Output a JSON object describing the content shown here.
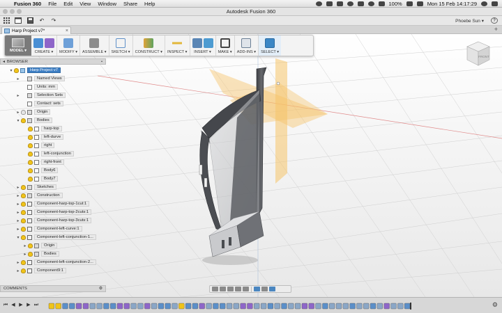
{
  "menubar": {
    "app_name": "Fusion 360",
    "items": [
      "File",
      "Edit",
      "View",
      "Window",
      "Share",
      "Help"
    ],
    "battery": "100%",
    "clock": "Mon 15 Feb  14:17:29"
  },
  "window": {
    "title": "Autodesk Fusion 360"
  },
  "quickbar": {
    "user": "Phoebe Sun ▾",
    "help": "?"
  },
  "document_tab": {
    "label": "Harp Project v7*",
    "close": "×"
  },
  "toolbar": {
    "workspace": "MODEL ▾",
    "groups": [
      {
        "label": "CREATE ▾",
        "colors": [
          "#4a8fd4",
          "#8e66c9"
        ]
      },
      {
        "label": "MODIFY ▾",
        "colors": [
          "#6ea0d8"
        ]
      },
      {
        "label": "ASSEMBLE ▾",
        "colors": [
          "#8d8d8d"
        ]
      },
      {
        "label": "SKETCH ▾",
        "colors": [
          "#5f90c8"
        ]
      },
      {
        "label": "CONSTRUCT ▾",
        "colors": [
          "#e0a33a"
        ]
      },
      {
        "label": "INSPECT ▾",
        "colors": [
          "#e2b73a"
        ]
      },
      {
        "label": "INSERT ▾",
        "colors": [
          "#5a86b5",
          "#4d9bd1"
        ]
      },
      {
        "label": "MAKE ▾",
        "colors": [
          "#444444"
        ]
      },
      {
        "label": "ADD-INS ▾",
        "colors": [
          "#6b7f95"
        ]
      },
      {
        "label": "SELECT ▾",
        "colors": [
          "#3b87c6"
        ]
      }
    ]
  },
  "viewcube": {
    "face": "FRONT"
  },
  "browser": {
    "header": "BROWSER",
    "nodes": [
      {
        "label": "Harp Project v7",
        "depth": 0,
        "expanded": true,
        "icon": "root",
        "bulb": "on",
        "selected": true
      },
      {
        "label": "Named Views",
        "depth": 1,
        "expanded": false,
        "icon": "folder",
        "bulb": "none"
      },
      {
        "label": "Units: mm",
        "depth": 1,
        "expanded": null,
        "icon": "box",
        "bulb": "none"
      },
      {
        "label": "Selection Sets",
        "depth": 1,
        "expanded": false,
        "icon": "folder",
        "bulb": "none"
      },
      {
        "label": "Contact: sets",
        "depth": 1,
        "expanded": null,
        "icon": "box",
        "bulb": "none"
      },
      {
        "label": "Origin",
        "depth": 1,
        "expanded": false,
        "icon": "folder",
        "bulb": "off"
      },
      {
        "label": "Bodies",
        "depth": 1,
        "expanded": true,
        "icon": "folder",
        "bulb": "on"
      },
      {
        "label": "harp-top",
        "depth": 2,
        "expanded": null,
        "icon": "box",
        "bulb": "on"
      },
      {
        "label": "left-durve",
        "depth": 2,
        "expanded": null,
        "icon": "box",
        "bulb": "on"
      },
      {
        "label": "right",
        "depth": 2,
        "expanded": null,
        "icon": "box",
        "bulb": "on"
      },
      {
        "label": "left-conjunction",
        "depth": 2,
        "expanded": null,
        "icon": "box",
        "bulb": "on"
      },
      {
        "label": "right-front",
        "depth": 2,
        "expanded": null,
        "icon": "box",
        "bulb": "on"
      },
      {
        "label": "Body6",
        "depth": 2,
        "expanded": null,
        "icon": "box",
        "bulb": "on"
      },
      {
        "label": "Body7",
        "depth": 2,
        "expanded": null,
        "icon": "box",
        "bulb": "on"
      },
      {
        "label": "Sketches",
        "depth": 1,
        "expanded": false,
        "icon": "folder",
        "bulb": "on"
      },
      {
        "label": "Construction",
        "depth": 1,
        "expanded": false,
        "icon": "folder",
        "bulb": "on"
      },
      {
        "label": "Component-harp-top-1cut:1",
        "depth": 1,
        "expanded": false,
        "icon": "comp",
        "bulb": "on"
      },
      {
        "label": "Component-harp-top-2cuts:1",
        "depth": 1,
        "expanded": false,
        "icon": "comp",
        "bulb": "on"
      },
      {
        "label": "Component-harp-top-3cuts:1",
        "depth": 1,
        "expanded": false,
        "icon": "comp",
        "bulb": "on"
      },
      {
        "label": "Component-left-curve:1",
        "depth": 1,
        "expanded": false,
        "icon": "comp",
        "bulb": "on"
      },
      {
        "label": "Component-left-conjunction-1...",
        "depth": 1,
        "expanded": true,
        "icon": "comp",
        "bulb": "on"
      },
      {
        "label": "Origin",
        "depth": 2,
        "expanded": false,
        "icon": "folder",
        "bulb": "on"
      },
      {
        "label": "Bodies",
        "depth": 2,
        "expanded": false,
        "icon": "folder",
        "bulb": "on"
      },
      {
        "label": "Component-left-conjunction-2...",
        "depth": 1,
        "expanded": false,
        "icon": "comp",
        "bulb": "on"
      },
      {
        "label": "Component9:1",
        "depth": 1,
        "expanded": false,
        "icon": "comp",
        "bulb": "on"
      }
    ]
  },
  "comments": {
    "label": "COMMENTS"
  },
  "timeline": {
    "features": [
      "sketch",
      "sketch",
      "extrude",
      "extrude",
      "body",
      "body",
      "comp",
      "comp",
      "extrude",
      "extrude",
      "body",
      "body",
      "comp",
      "comp",
      "body",
      "comp",
      "extrude",
      "extrude",
      "comp",
      "sketch",
      "extrude",
      "extrude",
      "body",
      "comp",
      "extrude",
      "extrude",
      "comp",
      "comp",
      "body",
      "body",
      "comp",
      "comp",
      "extrude",
      "comp",
      "extrude",
      "comp",
      "comp",
      "body",
      "body",
      "comp",
      "extrude",
      "comp",
      "comp",
      "comp",
      "extrude",
      "comp",
      "comp",
      "extrude",
      "comp",
      "body",
      "comp",
      "comp",
      "extrude"
    ]
  },
  "colors": {
    "accent": "#3d7ec3",
    "plane": "#f3c26b",
    "harp": "#4b4d52"
  }
}
